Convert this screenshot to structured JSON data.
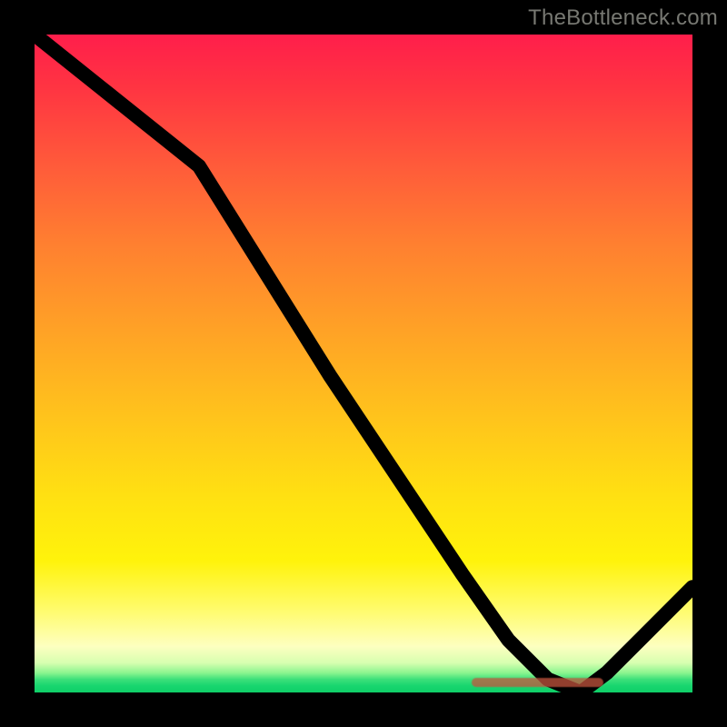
{
  "watermark": "TheBottleneck.com",
  "colors": {
    "gradient_top": "#ff1e4b",
    "gradient_mid": "#ffe012",
    "gradient_bottom": "#0fcf68",
    "curve": "#000000",
    "frame": "#000000",
    "blob": "#c3553e",
    "watermark": "#777872"
  },
  "chart_data": {
    "type": "line",
    "title": "",
    "xlabel": "",
    "ylabel": "",
    "xlim": [
      0,
      100
    ],
    "ylim": [
      0,
      100
    ],
    "series": [
      {
        "name": "curve",
        "x": [
          0,
          10,
          20,
          25,
          35,
          45,
          55,
          65,
          72,
          78,
          83,
          87,
          92,
          100
        ],
        "values": [
          100,
          92,
          84,
          80,
          64,
          48,
          33,
          18,
          8,
          2,
          0,
          3,
          8,
          16
        ]
      }
    ],
    "annotation_bar": {
      "x_start": 67,
      "x_end": 87,
      "y": 0
    }
  }
}
